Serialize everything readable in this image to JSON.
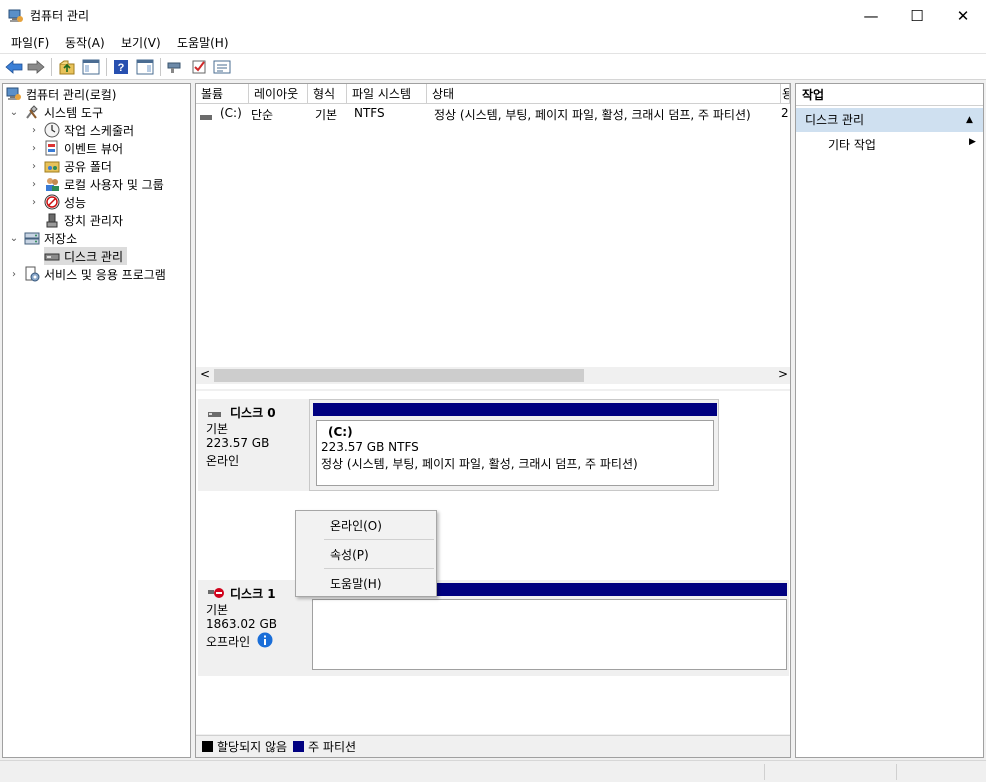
{
  "window": {
    "title": "컴퓨터 관리",
    "minimize": "—",
    "maximize": "☐",
    "close": "✕"
  },
  "menu": [
    "파일(F)",
    "동작(A)",
    "보기(V)",
    "도움말(H)"
  ],
  "toolbar": {
    "icons": [
      "back-icon",
      "forward-icon",
      "folder-up-icon",
      "show-hide-tree-icon",
      "help-icon",
      "show-hide-action-icon",
      "connect-icon",
      "check-icon",
      "properties-icon"
    ]
  },
  "tree": {
    "root": "컴퓨터 관리(로컬)",
    "system_tools": "시스템 도구",
    "task_scheduler": "작업 스케줄러",
    "event_viewer": "이벤트 뷰어",
    "shared_folders": "공유 폴더",
    "local_users": "로컬 사용자 및 그룹",
    "performance": "성능",
    "device_manager": "장치 관리자",
    "storage": "저장소",
    "disk_management": "디스크 관리",
    "services": "서비스 및 응용 프로그램"
  },
  "volume_list": {
    "columns": [
      "볼륨",
      "레이아웃",
      "형식",
      "파일 시스템",
      "상태",
      "용"
    ],
    "rows": [
      {
        "volume": "(C:)",
        "layout": "단순",
        "type": "기본",
        "fs": "NTFS",
        "status": "정상 (시스템, 부팅, 페이지 파일, 활성, 크래시 덤프, 주 파티션)",
        "capacity": "2:"
      }
    ],
    "scroll_left": "<",
    "scroll_right": ">"
  },
  "disks": [
    {
      "name": "디스크 0",
      "type": "기본",
      "size": "223.57 GB",
      "status": "온라인",
      "partition": {
        "label": "(C:)",
        "size": "223.57 GB NTFS",
        "status": "정상 (시스템, 부팅, 페이지 파일, 활성, 크래시 덤프, 주 파티션)"
      }
    },
    {
      "name": "디스크 1",
      "type": "기본",
      "size": "1863.02 GB",
      "status": "오프라인"
    }
  ],
  "legend": {
    "unallocated": "할당되지 않음",
    "primary": "주 파티션"
  },
  "actions": {
    "header": "작업",
    "selected": "디스크 관리",
    "more": "기타 작업"
  },
  "context_menu": {
    "online": "온라인(O)",
    "properties": "속성(P)",
    "help": "도움말(H)"
  },
  "colors": {
    "partition_bar": "#000080",
    "unallocated": "#000000",
    "selection": "#cfe0f0",
    "info_icon": "#1a6ed8",
    "offline_badge": "#d0021b"
  }
}
